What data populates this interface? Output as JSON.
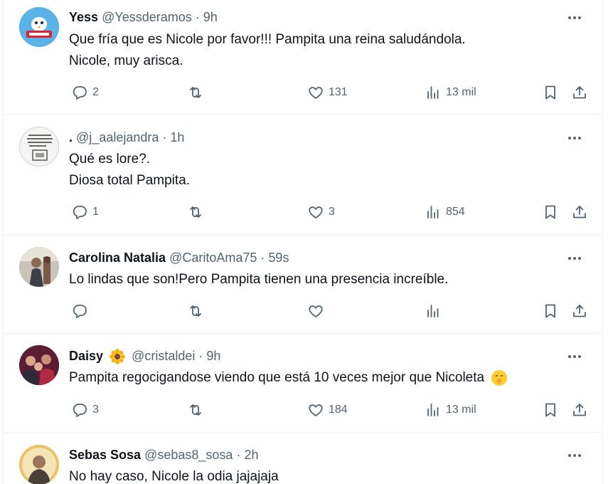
{
  "tweets": [
    {
      "name": "Yess",
      "handle": "@Yessderamos",
      "time": "9h",
      "lines": [
        "Que fría que es Nicole por favor!!! Pampita una reina saludándola.",
        "Nicole, muy arisca."
      ],
      "replies": "2",
      "retweets": "",
      "likes": "131",
      "views": "13 mil",
      "avatar_icon": "follow-me-bird-avatar"
    },
    {
      "name": ".",
      "handle": "@j_aalejandra",
      "time": "1h",
      "lines": [
        "Qué es lore?.",
        "Diosa total Pampita."
      ],
      "replies": "1",
      "retweets": "",
      "likes": "3",
      "views": "854",
      "avatar_icon": "text-note-avatar"
    },
    {
      "name": "Carolina Natalia",
      "handle": "@CaritoAma75",
      "time": "59s",
      "lines": [
        "Lo lindas que son!Pero Pampita  tienen una presencia increíble."
      ],
      "replies": "",
      "retweets": "",
      "likes": "",
      "views": "",
      "avatar_icon": "person-photo-avatar"
    },
    {
      "name": "Daisy",
      "handle": "@cristaldei",
      "time": "9h",
      "lines": [
        "Pampita regocigandose viendo que está 10 veces mejor que Nicoleta"
      ],
      "replies": "3",
      "retweets": "",
      "likes": "184",
      "views": "13 mil",
      "avatar_icon": "group-photo-avatar",
      "name_emoji": "sunflower-emoji",
      "text_emoji": "shushing-face-emoji"
    },
    {
      "name": "Sebas Sosa",
      "handle": "@sebas8_sosa",
      "time": "2h",
      "lines": [
        "No hay caso, Nicole la odia jajajaja"
      ],
      "avatar_icon": "man-photo-avatar"
    }
  ],
  "separator": "·",
  "colors": {
    "text": "#0f1419",
    "muted": "#536471",
    "border": "#eff3f4"
  }
}
